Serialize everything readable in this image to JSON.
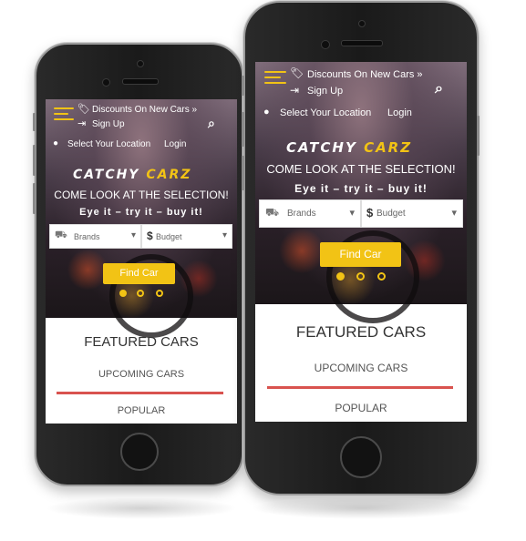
{
  "header": {
    "discounts_label": "Discounts On New Cars »",
    "signup_label": "Sign Up",
    "location_label": "Select Your Location",
    "login_label": "Login"
  },
  "hero": {
    "logo_part1": "CATCHY ",
    "logo_part2": "CARZ",
    "headline": "COME LOOK AT THE SELECTION!",
    "tagline": "Eye it – try it – buy it!"
  },
  "search": {
    "brands_label": "Brands",
    "budget_label": "Budget",
    "dropdown_arrow": "▾",
    "find_button": "Find Car"
  },
  "carousel": {
    "slides": 3,
    "active_index": 0
  },
  "content": {
    "featured_title": "FEATURED CARS",
    "tab_upcoming": "UPCOMING CARS",
    "tab_popular": "POPULAR"
  },
  "icons": {
    "menu": "hamburger-menu-icon",
    "tag": "tag-icon",
    "signin": "sign-in-icon",
    "search": "search-icon",
    "location": "map-marker-icon",
    "car": "car-icon",
    "dollar": "dollar-icon"
  },
  "colors": {
    "accent": "#f2c315",
    "underline": "#d9534f",
    "phone_body": "#1a1a1a"
  }
}
